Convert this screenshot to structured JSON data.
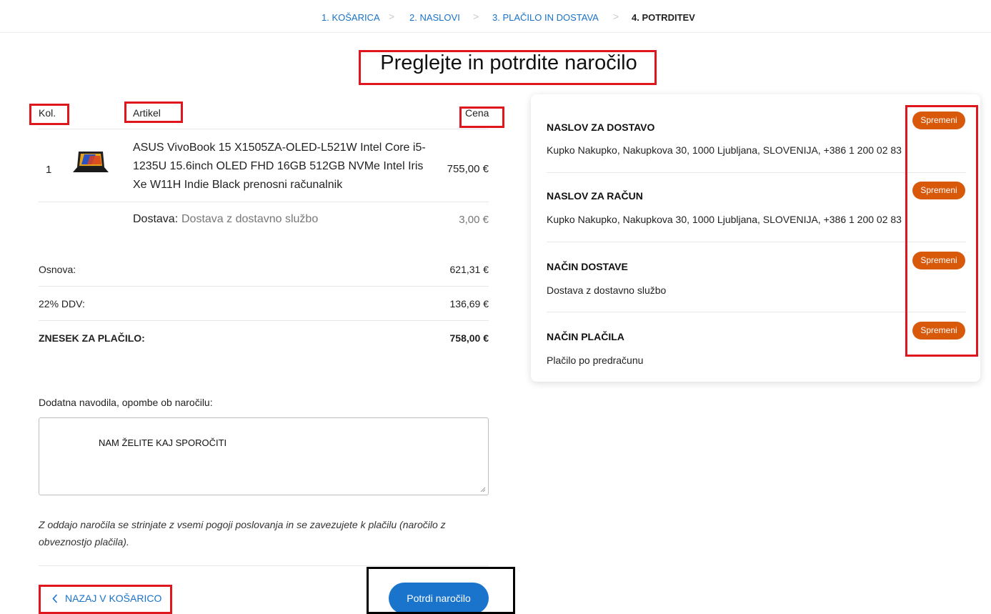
{
  "breadcrumb": {
    "steps": [
      {
        "label": "1. KOŠARICA"
      },
      {
        "label": "2. NASLOVI"
      },
      {
        "label": "3. PLAČILO IN DOSTAVA"
      },
      {
        "label": "4. POTRDITEV"
      }
    ],
    "separator": ">"
  },
  "page_title": "Preglejte in potrdite naročilo",
  "table": {
    "headers": {
      "qty": "Kol.",
      "item": "Artikel",
      "price": "Cena"
    },
    "rows": [
      {
        "qty": "1",
        "name": "ASUS VivoBook 15 X1505ZA-OLED-L521W Intel Core i5-1235U 15.6inch OLED FHD 16GB 512GB NVMe Intel Iris Xe W11H Indie Black prenosni računalnik",
        "price": "755,00 €",
        "image_icon": "laptop-thumbnail"
      }
    ],
    "shipping": {
      "label": "Dostava:",
      "value": "Dostava z dostavno službo",
      "price": "3,00 €"
    }
  },
  "totals": {
    "base_label": "Osnova:",
    "base_value": "621,31 €",
    "vat_label": "22% DDV:",
    "vat_value": "136,69 €",
    "total_label": "ZNESEK ZA PLAČILO:",
    "total_value": "758,00 €"
  },
  "notes": {
    "label": "Dodatna navodila, opombe ob naročilu:",
    "value": "NAM ŽELITE KAJ SPOROČITI"
  },
  "terms_text": "Z oddajo naročila se strinjate z vsemi pogoji poslovanja in se zavezujete k plačilu (naročilo z obveznostjo plačila).",
  "actions": {
    "back_label": "NAZAJ V KOŠARICO",
    "back_icon": "chevron-left-icon",
    "confirm_label": "Potrdi naročilo"
  },
  "summary": {
    "sections": [
      {
        "title": "NASLOV ZA DOSTAVO",
        "text": "Kupko Nakupko, Nakupkova 30, 1000 Ljubljana, SLOVENIJA, +386 1 200 02 83",
        "button": "Spremeni"
      },
      {
        "title": "NASLOV ZA RAČUN",
        "text": "Kupko Nakupko, Nakupkova 30, 1000 Ljubljana, SLOVENIJA, +386 1 200 02 83",
        "button": "Spremeni"
      },
      {
        "title": "NAČIN DOSTAVE",
        "text": "Dostava z dostavno službo",
        "button": "Spremeni"
      },
      {
        "title": "NAČIN PLAČILA",
        "text": "Plačilo po predračunu",
        "button": "Spremeni"
      }
    ]
  },
  "colors": {
    "link": "#1a73c8",
    "primary_button": "#1b74cc",
    "change_button": "#d9590b",
    "annotation_red": "#e0161f",
    "annotation_black": "#000000"
  }
}
